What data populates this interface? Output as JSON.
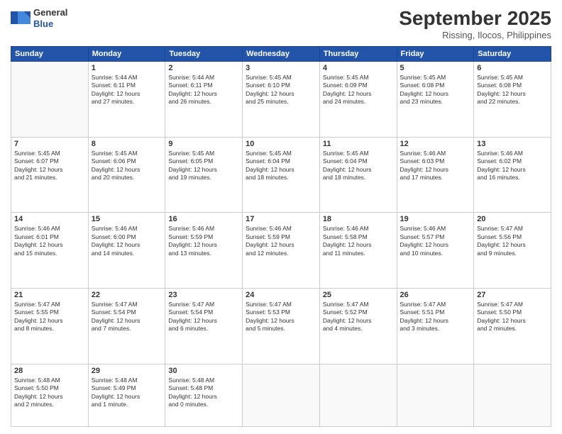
{
  "header": {
    "logo": {
      "general": "General",
      "blue": "Blue"
    },
    "title": "September 2025",
    "subtitle": "Rissing, Ilocos, Philippines"
  },
  "weekdays": [
    "Sunday",
    "Monday",
    "Tuesday",
    "Wednesday",
    "Thursday",
    "Friday",
    "Saturday"
  ],
  "weeks": [
    [
      {
        "day": "",
        "info": ""
      },
      {
        "day": "1",
        "info": "Sunrise: 5:44 AM\nSunset: 6:11 PM\nDaylight: 12 hours\nand 27 minutes."
      },
      {
        "day": "2",
        "info": "Sunrise: 5:44 AM\nSunset: 6:11 PM\nDaylight: 12 hours\nand 26 minutes."
      },
      {
        "day": "3",
        "info": "Sunrise: 5:45 AM\nSunset: 6:10 PM\nDaylight: 12 hours\nand 25 minutes."
      },
      {
        "day": "4",
        "info": "Sunrise: 5:45 AM\nSunset: 6:09 PM\nDaylight: 12 hours\nand 24 minutes."
      },
      {
        "day": "5",
        "info": "Sunrise: 5:45 AM\nSunset: 6:08 PM\nDaylight: 12 hours\nand 23 minutes."
      },
      {
        "day": "6",
        "info": "Sunrise: 5:45 AM\nSunset: 6:08 PM\nDaylight: 12 hours\nand 22 minutes."
      }
    ],
    [
      {
        "day": "7",
        "info": "Sunrise: 5:45 AM\nSunset: 6:07 PM\nDaylight: 12 hours\nand 21 minutes."
      },
      {
        "day": "8",
        "info": "Sunrise: 5:45 AM\nSunset: 6:06 PM\nDaylight: 12 hours\nand 20 minutes."
      },
      {
        "day": "9",
        "info": "Sunrise: 5:45 AM\nSunset: 6:05 PM\nDaylight: 12 hours\nand 19 minutes."
      },
      {
        "day": "10",
        "info": "Sunrise: 5:45 AM\nSunset: 6:04 PM\nDaylight: 12 hours\nand 18 minutes."
      },
      {
        "day": "11",
        "info": "Sunrise: 5:45 AM\nSunset: 6:04 PM\nDaylight: 12 hours\nand 18 minutes."
      },
      {
        "day": "12",
        "info": "Sunrise: 5:46 AM\nSunset: 6:03 PM\nDaylight: 12 hours\nand 17 minutes."
      },
      {
        "day": "13",
        "info": "Sunrise: 5:46 AM\nSunset: 6:02 PM\nDaylight: 12 hours\nand 16 minutes."
      }
    ],
    [
      {
        "day": "14",
        "info": "Sunrise: 5:46 AM\nSunset: 6:01 PM\nDaylight: 12 hours\nand 15 minutes."
      },
      {
        "day": "15",
        "info": "Sunrise: 5:46 AM\nSunset: 6:00 PM\nDaylight: 12 hours\nand 14 minutes."
      },
      {
        "day": "16",
        "info": "Sunrise: 5:46 AM\nSunset: 5:59 PM\nDaylight: 12 hours\nand 13 minutes."
      },
      {
        "day": "17",
        "info": "Sunrise: 5:46 AM\nSunset: 5:59 PM\nDaylight: 12 hours\nand 12 minutes."
      },
      {
        "day": "18",
        "info": "Sunrise: 5:46 AM\nSunset: 5:58 PM\nDaylight: 12 hours\nand 11 minutes."
      },
      {
        "day": "19",
        "info": "Sunrise: 5:46 AM\nSunset: 5:57 PM\nDaylight: 12 hours\nand 10 minutes."
      },
      {
        "day": "20",
        "info": "Sunrise: 5:47 AM\nSunset: 5:56 PM\nDaylight: 12 hours\nand 9 minutes."
      }
    ],
    [
      {
        "day": "21",
        "info": "Sunrise: 5:47 AM\nSunset: 5:55 PM\nDaylight: 12 hours\nand 8 minutes."
      },
      {
        "day": "22",
        "info": "Sunrise: 5:47 AM\nSunset: 5:54 PM\nDaylight: 12 hours\nand 7 minutes."
      },
      {
        "day": "23",
        "info": "Sunrise: 5:47 AM\nSunset: 5:54 PM\nDaylight: 12 hours\nand 6 minutes."
      },
      {
        "day": "24",
        "info": "Sunrise: 5:47 AM\nSunset: 5:53 PM\nDaylight: 12 hours\nand 5 minutes."
      },
      {
        "day": "25",
        "info": "Sunrise: 5:47 AM\nSunset: 5:52 PM\nDaylight: 12 hours\nand 4 minutes."
      },
      {
        "day": "26",
        "info": "Sunrise: 5:47 AM\nSunset: 5:51 PM\nDaylight: 12 hours\nand 3 minutes."
      },
      {
        "day": "27",
        "info": "Sunrise: 5:47 AM\nSunset: 5:50 PM\nDaylight: 12 hours\nand 2 minutes."
      }
    ],
    [
      {
        "day": "28",
        "info": "Sunrise: 5:48 AM\nSunset: 5:50 PM\nDaylight: 12 hours\nand 2 minutes."
      },
      {
        "day": "29",
        "info": "Sunrise: 5:48 AM\nSunset: 5:49 PM\nDaylight: 12 hours\nand 1 minute."
      },
      {
        "day": "30",
        "info": "Sunrise: 5:48 AM\nSunset: 5:48 PM\nDaylight: 12 hours\nand 0 minutes."
      },
      {
        "day": "",
        "info": ""
      },
      {
        "day": "",
        "info": ""
      },
      {
        "day": "",
        "info": ""
      },
      {
        "day": "",
        "info": ""
      }
    ]
  ]
}
